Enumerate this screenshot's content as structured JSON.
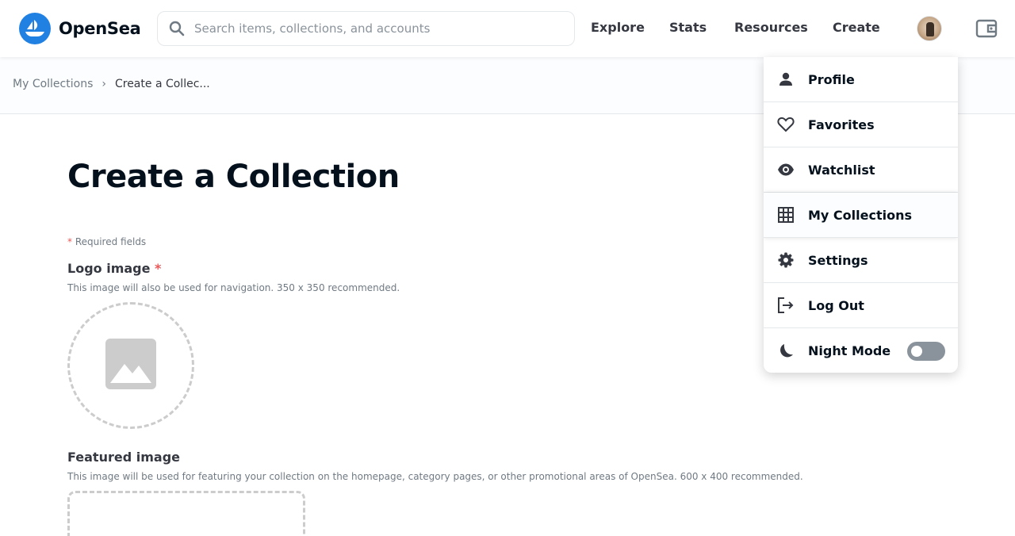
{
  "brand": {
    "name": "OpenSea",
    "color": "#2081e2"
  },
  "search": {
    "placeholder": "Search items, collections, and accounts"
  },
  "nav": {
    "explore": "Explore",
    "stats": "Stats",
    "resources": "Resources",
    "create": "Create"
  },
  "breadcrumb": {
    "parent": "My Collections",
    "separator": "›",
    "current": "Create a Collec..."
  },
  "page": {
    "title": "Create a Collection",
    "required_star": "*",
    "required_note": " Required fields",
    "logo_label": "Logo image ",
    "logo_desc": "This image will also be used for navigation. 350 x 350 recommended.",
    "featured_label": "Featured image",
    "featured_desc": "This image will be used for featuring your collection on the homepage, category pages, or other promotional areas of OpenSea. 600 x 400 recommended."
  },
  "menu": {
    "items": [
      {
        "label": "Profile",
        "icon": "person-icon"
      },
      {
        "label": "Favorites",
        "icon": "heart-icon"
      },
      {
        "label": "Watchlist",
        "icon": "eye-icon"
      },
      {
        "label": "My Collections",
        "icon": "grid-icon",
        "active": true
      },
      {
        "label": "Settings",
        "icon": "gear-icon"
      },
      {
        "label": "Log Out",
        "icon": "logout-icon"
      },
      {
        "label": "Night Mode",
        "icon": "moon-icon",
        "toggle": false
      }
    ]
  }
}
